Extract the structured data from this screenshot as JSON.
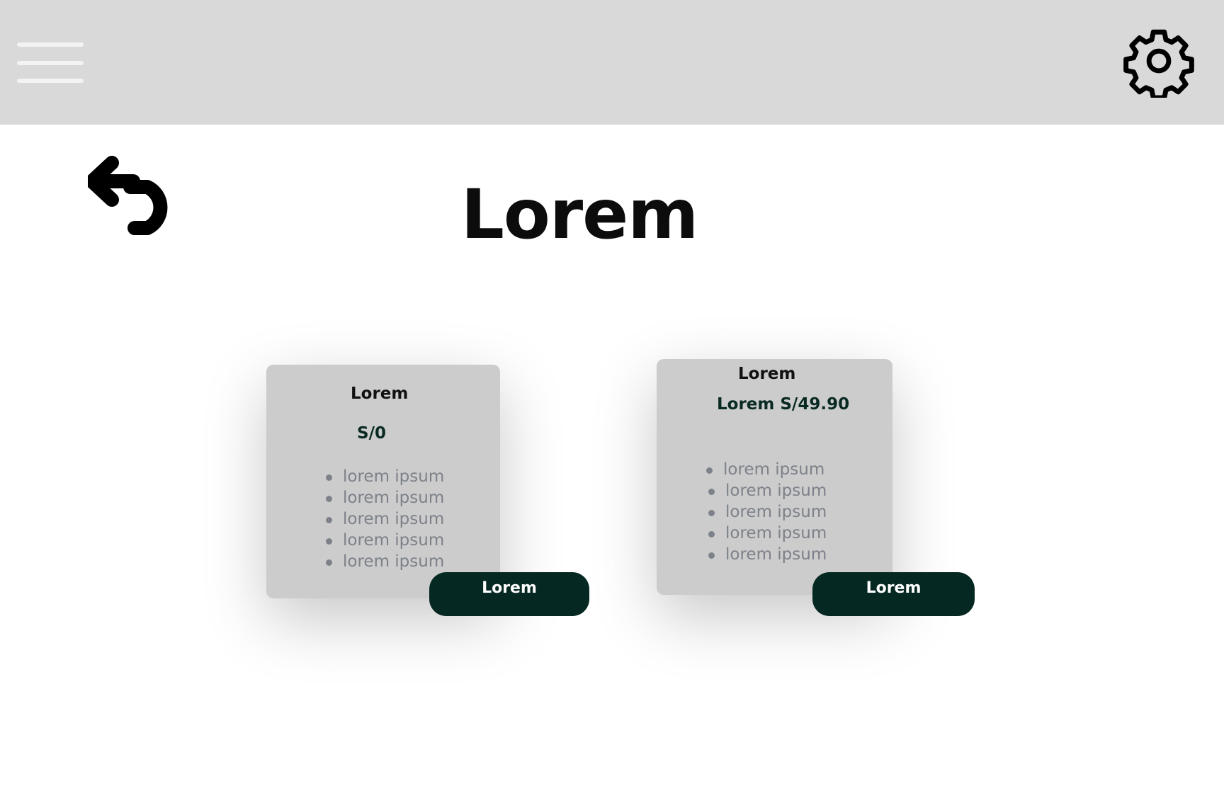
{
  "header": {
    "menu_icon": "hamburger-menu-icon",
    "settings_icon": "gear-icon"
  },
  "page": {
    "back_icon": "undo-arrow-icon",
    "title": "Lorem"
  },
  "plans": [
    {
      "title": "Lorem",
      "price": "S/0",
      "features": [
        "lorem  ipsum",
        "lorem ipsum",
        "lorem ipsum",
        "lorem ipsum",
        "lorem ipsum"
      ],
      "button_label": "Lorem"
    },
    {
      "title": "Lorem",
      "price": "Lorem S/49.90",
      "features": [
        "lorem  ipsum",
        "lorem ipsum",
        "lorem ipsum",
        "lorem ipsum",
        "lorem ipsum"
      ],
      "button_label": "Lorem"
    }
  ],
  "colors": {
    "topbar": "#d9d9d9",
    "card": "#cccccc",
    "accent": "#062822",
    "feature_text": "#7d8189"
  }
}
